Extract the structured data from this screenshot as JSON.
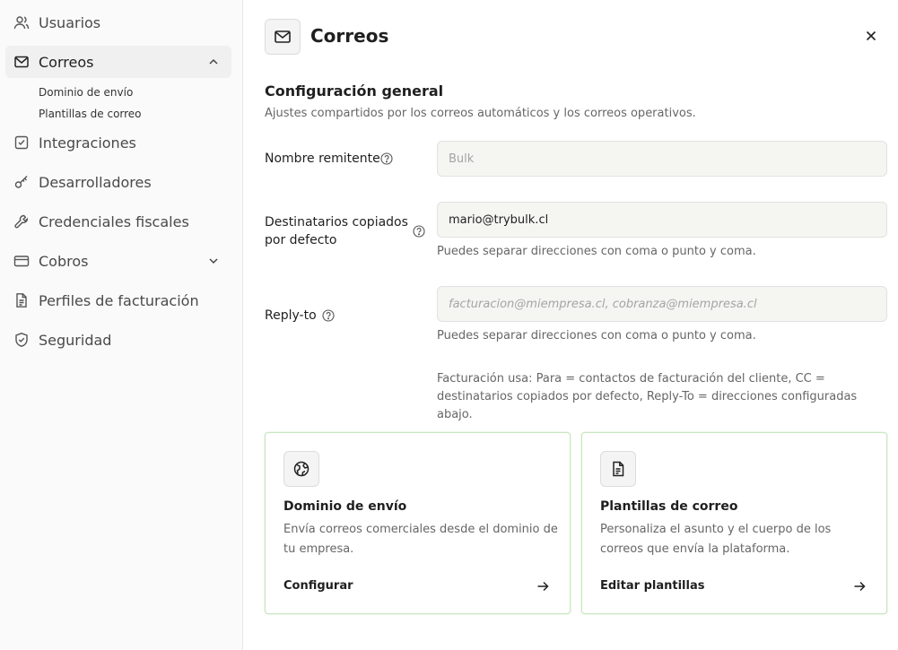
{
  "sidebar": {
    "items": [
      {
        "label": "Usuarios",
        "icon": "users-icon"
      },
      {
        "label": "Correos",
        "icon": "mail-icon",
        "expanded": true
      },
      {
        "label": "Integraciones",
        "icon": "checkbox-icon"
      },
      {
        "label": "Desarrolladores",
        "icon": "key-icon"
      },
      {
        "label": "Credenciales fiscales",
        "icon": "wrench-icon"
      },
      {
        "label": "Cobros",
        "icon": "credit-card-icon"
      },
      {
        "label": "Perfiles de facturación",
        "icon": "document-icon"
      },
      {
        "label": "Seguridad",
        "icon": "shield-icon"
      }
    ],
    "subitems": [
      {
        "label": "Dominio de envío"
      },
      {
        "label": "Plantillas de correo"
      }
    ]
  },
  "header": {
    "title": "Correos",
    "icon": "mail-icon"
  },
  "section": {
    "title": "Configuración general",
    "description": "Ajustes compartidos por los correos automáticos y los correos operativos."
  },
  "fields": {
    "sender": {
      "label": "Nombre remitente",
      "value": "",
      "placeholder": "Bulk"
    },
    "cc": {
      "label": "Destinatarios copiados por defecto",
      "value": "mario@trybulk.cl",
      "hint": "Puedes separar direcciones con coma o punto y coma."
    },
    "reply_to": {
      "label": "Reply-to",
      "value": "",
      "placeholder": "facturacion@miempresa.cl, cobranza@miempresa.cl",
      "hint": "Puedes separar direcciones con coma o punto y coma."
    }
  },
  "note": "Facturación usa: Para = contactos de facturación del cliente, CC = destinatarios copiados por defecto, Reply-To = direcciones configuradas abajo.",
  "cards": [
    {
      "title": "Dominio de envío",
      "description": "Envía correos comerciales desde el dominio de tu empresa.",
      "action": "Configurar",
      "icon": "globe-icon"
    },
    {
      "title": "Plantillas de correo",
      "description": "Personaliza el asunto y el cuerpo de los correos que envía la plataforma.",
      "action": "Editar plantillas",
      "icon": "document-icon"
    }
  ],
  "colors": {
    "card_border": "#c8e6c0",
    "input_bg": "#f5f5f2"
  }
}
